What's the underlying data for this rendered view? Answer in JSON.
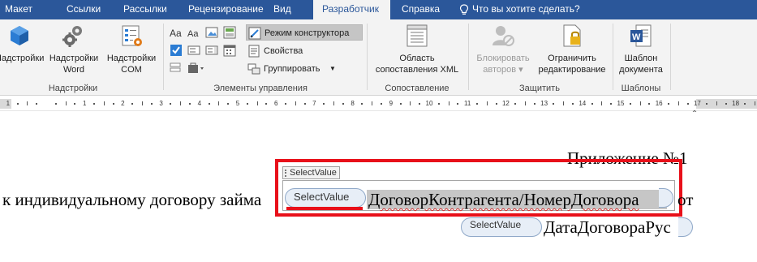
{
  "tabs": [
    {
      "label": "Макет",
      "active": false
    },
    {
      "label": "Ссылки",
      "active": false
    },
    {
      "label": "Рассылки",
      "active": false
    },
    {
      "label": "Рецензирование",
      "active": false
    },
    {
      "label": "Вид",
      "active": false
    },
    {
      "label": "Разработчик",
      "active": true
    },
    {
      "label": "Справка",
      "active": false
    }
  ],
  "tell_me": "Что вы хотите сделать?",
  "ribbon": {
    "addins": {
      "group_label": "Надстройки",
      "addins_btn": "Надстройки",
      "word_addins_l1": "Надстройки",
      "word_addins_l2": "Word",
      "com_addins_l1": "Надстройки",
      "com_addins_l2": "COM"
    },
    "controls": {
      "group_label": "Элементы управления",
      "design_mode": "Режим конструктора",
      "properties": "Свойства",
      "group": "Группировать"
    },
    "mapping": {
      "group_label": "Сопоставление",
      "pane_l1": "Область",
      "pane_l2": "сопоставления XML"
    },
    "protect": {
      "group_label": "Защитить",
      "block_l1": "Блокировать",
      "block_l2": "авторов",
      "restrict_l1": "Ограничить",
      "restrict_l2": "редактирование"
    },
    "templates": {
      "group_label": "Шаблоны",
      "doc_template_l1": "Шаблон",
      "doc_template_l2": "документа"
    }
  },
  "ruler": {
    "numbers": [
      "1",
      "1",
      "2",
      "3",
      "4",
      "5",
      "6",
      "7",
      "8",
      "9",
      "10",
      "11",
      "12",
      "13",
      "14",
      "15",
      "16",
      "17",
      "18"
    ]
  },
  "document": {
    "appendix": "Приложение №1",
    "line2_prefix": "к индивидуальному договору займа",
    "line2_suffix": "от",
    "cc_tag": "SelectValue",
    "cc_field_label": "SelectValue",
    "cc_field_text": "ДоговорКонтрагента/НомерДоговора",
    "line3_field_label": "SelectValue",
    "line3_field_text": "ДатаДоговораРус"
  },
  "colors": {
    "tab_bar": "#2b579a",
    "ribbon_bg": "#f3f3f3",
    "highlight": "#e8101a",
    "field_bg": "#c6c6c6"
  }
}
